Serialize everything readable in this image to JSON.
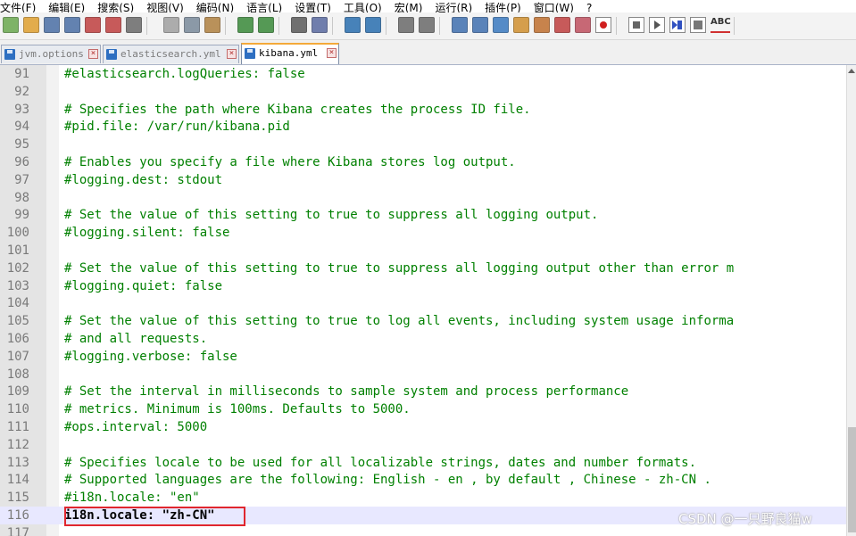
{
  "menu": [
    "文件(F)",
    "编辑(E)",
    "搜索(S)",
    "视图(V)",
    "编码(N)",
    "语言(L)",
    "设置(T)",
    "工具(O)",
    "宏(M)",
    "运行(R)",
    "插件(P)",
    "窗口(W)",
    "?"
  ],
  "toolbar": {
    "icons": [
      "new-file-icon",
      "open-file-icon",
      "save-icon",
      "save-all-icon",
      "close-icon",
      "close-all-icon",
      "print-icon",
      "cut-icon",
      "copy-icon",
      "paste-icon",
      "undo-icon",
      "redo-icon",
      "find-icon",
      "replace-icon",
      "zoom-in-icon",
      "zoom-out-icon",
      "sync-vertical-icon",
      "sync-horizontal-icon",
      "word-wrap-icon",
      "show-all-chars-icon",
      "indent-guide-icon",
      "doc-map-icon",
      "function-list-icon",
      "folder-workspace-icon",
      "monitoring-icon",
      "record-macro-icon",
      "stop-record-icon",
      "play-macro-icon",
      "run-macro-multiple-icon",
      "save-macro-icon",
      "spell-check-icon"
    ],
    "spell_label": "ABC"
  },
  "tabs": [
    {
      "label": "jvm.options",
      "active": false
    },
    {
      "label": "elasticsearch.yml",
      "active": false
    },
    {
      "label": "kibana.yml",
      "active": true
    }
  ],
  "lines": [
    {
      "n": "91",
      "text": "#elasticsearch.logQueries: false"
    },
    {
      "n": "92",
      "text": ""
    },
    {
      "n": "93",
      "text": "# Specifies the path where Kibana creates the process ID file."
    },
    {
      "n": "94",
      "text": "#pid.file: /var/run/kibana.pid"
    },
    {
      "n": "95",
      "text": ""
    },
    {
      "n": "96",
      "text": "# Enables you specify a file where Kibana stores log output."
    },
    {
      "n": "97",
      "text": "#logging.dest: stdout"
    },
    {
      "n": "98",
      "text": ""
    },
    {
      "n": "99",
      "text": "# Set the value of this setting to true to suppress all logging output."
    },
    {
      "n": "100",
      "text": "#logging.silent: false"
    },
    {
      "n": "101",
      "text": ""
    },
    {
      "n": "102",
      "text": "# Set the value of this setting to true to suppress all logging output other than error m"
    },
    {
      "n": "103",
      "text": "#logging.quiet: false"
    },
    {
      "n": "104",
      "text": ""
    },
    {
      "n": "105",
      "text": "# Set the value of this setting to true to log all events, including system usage informa"
    },
    {
      "n": "106",
      "text": "# and all requests."
    },
    {
      "n": "107",
      "text": "#logging.verbose: false"
    },
    {
      "n": "108",
      "text": ""
    },
    {
      "n": "109",
      "text": "# Set the interval in milliseconds to sample system and process performance"
    },
    {
      "n": "110",
      "text": "# metrics. Minimum is 100ms. Defaults to 5000."
    },
    {
      "n": "111",
      "text": "#ops.interval: 5000"
    },
    {
      "n": "112",
      "text": ""
    },
    {
      "n": "113",
      "text": "# Specifies locale to be used for all localizable strings, dates and number formats."
    },
    {
      "n": "114",
      "text": "# Supported languages are the following: English - en , by default , Chinese - zh-CN ."
    },
    {
      "n": "115",
      "text": "#i18n.locale: \"en\""
    },
    {
      "n": "116",
      "text": "i18n.locale: \"zh-CN\"",
      "current": true
    },
    {
      "n": "117",
      "text": ""
    }
  ],
  "watermark": "CSDN @一只野良猫w",
  "colors": {
    "comment": "#008000",
    "highlight_box": "#e0262e",
    "current_line": "#e8e8ff",
    "active_tab_accent": "#f4a93a"
  }
}
